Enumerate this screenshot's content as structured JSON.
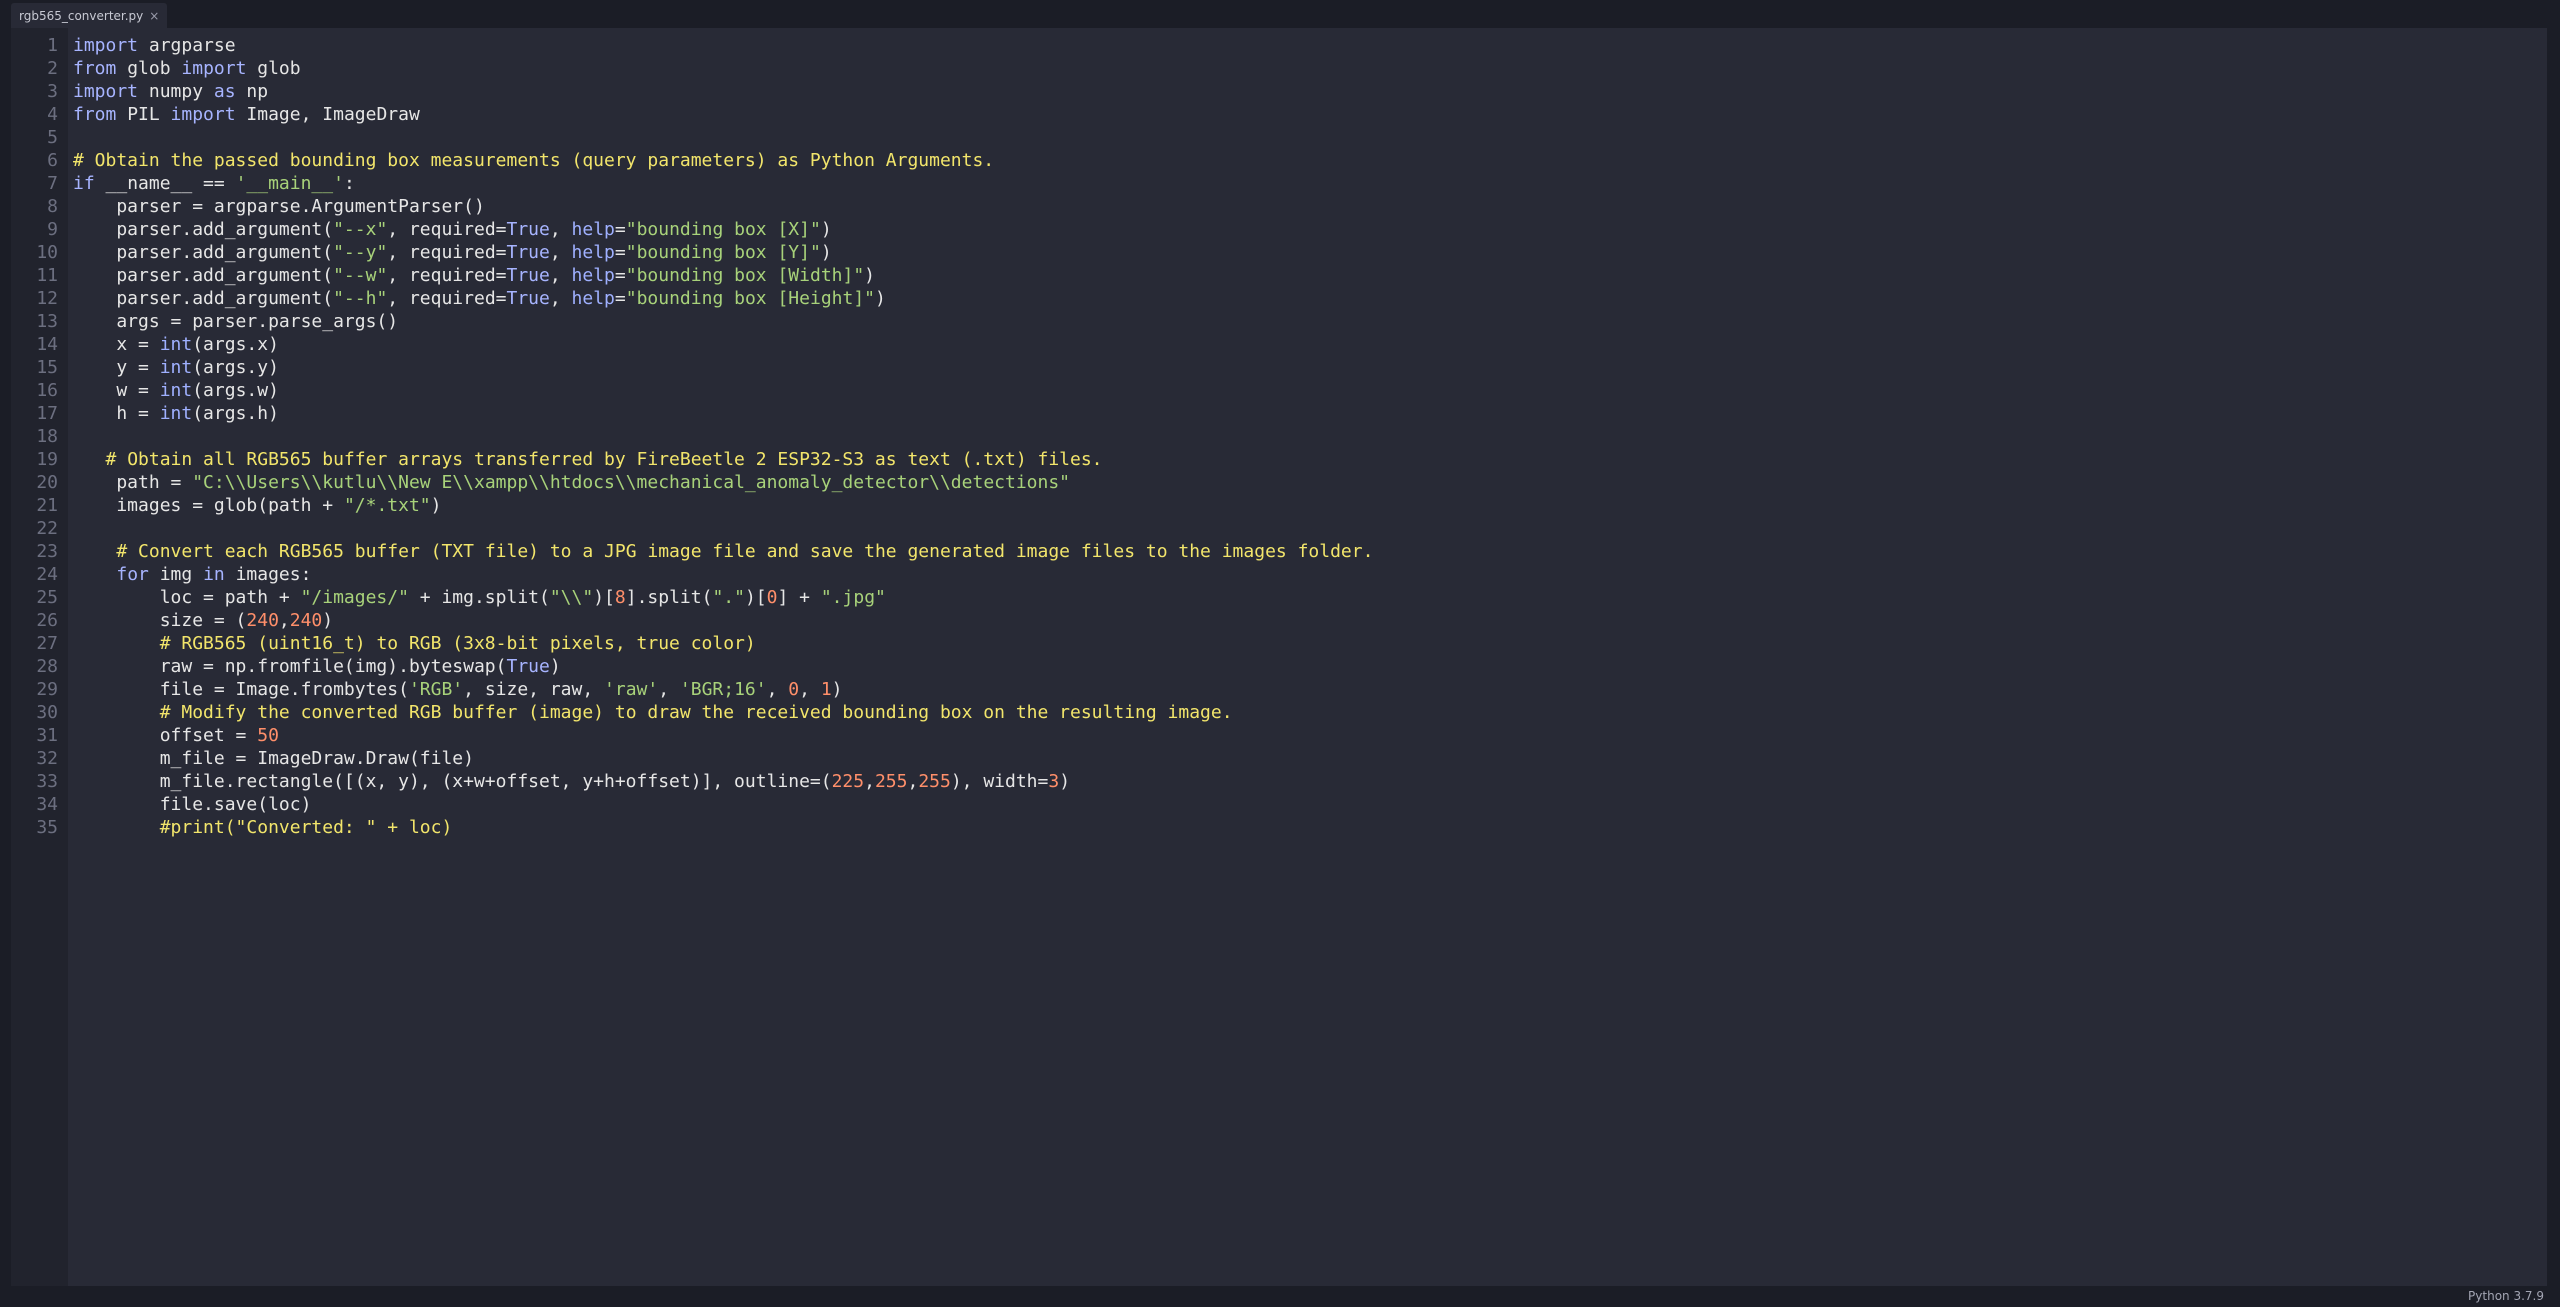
{
  "tab": {
    "filename": "rgb565_converter.py",
    "close_glyph": "×"
  },
  "status": {
    "language": "Python 3.7.9"
  },
  "colors": {
    "keyword": "#a7b4ff",
    "string": "#a8d27a",
    "number": "#ff8f6a",
    "comment": "#f2e56b",
    "text": "#e6e6e6",
    "editor_bg": "#282a36",
    "gutter_bg": "#21232d"
  },
  "code_lines": [
    [
      [
        "kw",
        "import"
      ],
      [
        "t",
        " argparse"
      ]
    ],
    [
      [
        "kw",
        "from"
      ],
      [
        "t",
        " glob "
      ],
      [
        "kw",
        "import"
      ],
      [
        "t",
        " glob"
      ]
    ],
    [
      [
        "kw",
        "import"
      ],
      [
        "t",
        " numpy "
      ],
      [
        "kw",
        "as"
      ],
      [
        "t",
        " np"
      ]
    ],
    [
      [
        "kw",
        "from"
      ],
      [
        "t",
        " PIL "
      ],
      [
        "kw",
        "import"
      ],
      [
        "t",
        " Image, ImageDraw"
      ]
    ],
    [],
    [
      [
        "cm",
        "# Obtain the passed bounding box measurements (query parameters) as Python Arguments."
      ]
    ],
    [
      [
        "kw",
        "if"
      ],
      [
        "t",
        " __name__ == "
      ],
      [
        "str",
        "'__main__'"
      ],
      [
        "t",
        ":"
      ]
    ],
    [
      [
        "t",
        "    parser = argparse.ArgumentParser()"
      ]
    ],
    [
      [
        "t",
        "    parser.add_argument("
      ],
      [
        "str",
        "\"--x\""
      ],
      [
        "t",
        ", required="
      ],
      [
        "kw",
        "True"
      ],
      [
        "t",
        ", "
      ],
      [
        "bi",
        "help"
      ],
      [
        "t",
        "="
      ],
      [
        "str",
        "\"bounding box [X]\""
      ],
      [
        "t",
        ")"
      ]
    ],
    [
      [
        "t",
        "    parser.add_argument("
      ],
      [
        "str",
        "\"--y\""
      ],
      [
        "t",
        ", required="
      ],
      [
        "kw",
        "True"
      ],
      [
        "t",
        ", "
      ],
      [
        "bi",
        "help"
      ],
      [
        "t",
        "="
      ],
      [
        "str",
        "\"bounding box [Y]\""
      ],
      [
        "t",
        ")"
      ]
    ],
    [
      [
        "t",
        "    parser.add_argument("
      ],
      [
        "str",
        "\"--w\""
      ],
      [
        "t",
        ", required="
      ],
      [
        "kw",
        "True"
      ],
      [
        "t",
        ", "
      ],
      [
        "bi",
        "help"
      ],
      [
        "t",
        "="
      ],
      [
        "str",
        "\"bounding box [Width]\""
      ],
      [
        "t",
        ")"
      ]
    ],
    [
      [
        "t",
        "    parser.add_argument("
      ],
      [
        "str",
        "\"--h\""
      ],
      [
        "t",
        ", required="
      ],
      [
        "kw",
        "True"
      ],
      [
        "t",
        ", "
      ],
      [
        "bi",
        "help"
      ],
      [
        "t",
        "="
      ],
      [
        "str",
        "\"bounding box [Height]\""
      ],
      [
        "t",
        ")"
      ]
    ],
    [
      [
        "t",
        "    args = parser.parse_args()"
      ]
    ],
    [
      [
        "t",
        "    x = "
      ],
      [
        "bi",
        "int"
      ],
      [
        "t",
        "(args.x)"
      ]
    ],
    [
      [
        "t",
        "    y = "
      ],
      [
        "bi",
        "int"
      ],
      [
        "t",
        "(args.y)"
      ]
    ],
    [
      [
        "t",
        "    w = "
      ],
      [
        "bi",
        "int"
      ],
      [
        "t",
        "(args.w)"
      ]
    ],
    [
      [
        "t",
        "    h = "
      ],
      [
        "bi",
        "int"
      ],
      [
        "t",
        "(args.h)"
      ]
    ],
    [],
    [
      [
        "t",
        "   "
      ],
      [
        "cm",
        "# Obtain all RGB565 buffer arrays transferred by FireBeetle 2 ESP32-S3 as text (.txt) files."
      ]
    ],
    [
      [
        "t",
        "    path = "
      ],
      [
        "str",
        "\"C:\\\\Users\\\\kutlu\\\\New E\\\\xampp\\\\htdocs\\\\mechanical_anomaly_detector\\\\detections\""
      ]
    ],
    [
      [
        "t",
        "    images = glob(path + "
      ],
      [
        "str",
        "\"/*.txt\""
      ],
      [
        "t",
        ")"
      ]
    ],
    [],
    [
      [
        "t",
        "    "
      ],
      [
        "cm",
        "# Convert each RGB565 buffer (TXT file) to a JPG image file and save the generated image files to the images folder."
      ]
    ],
    [
      [
        "t",
        "    "
      ],
      [
        "kw",
        "for"
      ],
      [
        "t",
        " img "
      ],
      [
        "kw",
        "in"
      ],
      [
        "t",
        " images:"
      ]
    ],
    [
      [
        "t",
        "        loc = path + "
      ],
      [
        "str",
        "\"/images/\""
      ],
      [
        "t",
        " + img.split("
      ],
      [
        "str",
        "\"\\\\\""
      ],
      [
        "t",
        ")["
      ],
      [
        "num",
        "8"
      ],
      [
        "t",
        "].split("
      ],
      [
        "str",
        "\".\""
      ],
      [
        "t",
        ")["
      ],
      [
        "num",
        "0"
      ],
      [
        "t",
        "] + "
      ],
      [
        "str",
        "\".jpg\""
      ]
    ],
    [
      [
        "t",
        "        size = ("
      ],
      [
        "num",
        "240"
      ],
      [
        "t",
        ","
      ],
      [
        "num",
        "240"
      ],
      [
        "t",
        ")"
      ]
    ],
    [
      [
        "t",
        "        "
      ],
      [
        "cm",
        "# RGB565 (uint16_t) to RGB (3x8-bit pixels, true color)"
      ]
    ],
    [
      [
        "t",
        "        raw = np.fromfile(img).byteswap("
      ],
      [
        "kw",
        "True"
      ],
      [
        "t",
        ")"
      ]
    ],
    [
      [
        "t",
        "        file = Image.frombytes("
      ],
      [
        "str",
        "'RGB'"
      ],
      [
        "t",
        ", size, raw, "
      ],
      [
        "str",
        "'raw'"
      ],
      [
        "t",
        ", "
      ],
      [
        "str",
        "'BGR;16'"
      ],
      [
        "t",
        ", "
      ],
      [
        "num",
        "0"
      ],
      [
        "t",
        ", "
      ],
      [
        "num",
        "1"
      ],
      [
        "t",
        ")"
      ]
    ],
    [
      [
        "t",
        "        "
      ],
      [
        "cm",
        "# Modify the converted RGB buffer (image) to draw the received bounding box on the resulting image."
      ]
    ],
    [
      [
        "t",
        "        offset = "
      ],
      [
        "num",
        "50"
      ]
    ],
    [
      [
        "t",
        "        m_file = ImageDraw.Draw(file)"
      ]
    ],
    [
      [
        "t",
        "        m_file.rectangle([(x, y), (x+w+offset, y+h+offset)], outline=("
      ],
      [
        "num",
        "225"
      ],
      [
        "t",
        ","
      ],
      [
        "num",
        "255"
      ],
      [
        "t",
        ","
      ],
      [
        "num",
        "255"
      ],
      [
        "t",
        "), width="
      ],
      [
        "num",
        "3"
      ],
      [
        "t",
        ")"
      ]
    ],
    [
      [
        "t",
        "        file.save(loc)"
      ]
    ],
    [
      [
        "t",
        "        "
      ],
      [
        "cm",
        "#print(\"Converted: \" + loc)"
      ]
    ]
  ]
}
